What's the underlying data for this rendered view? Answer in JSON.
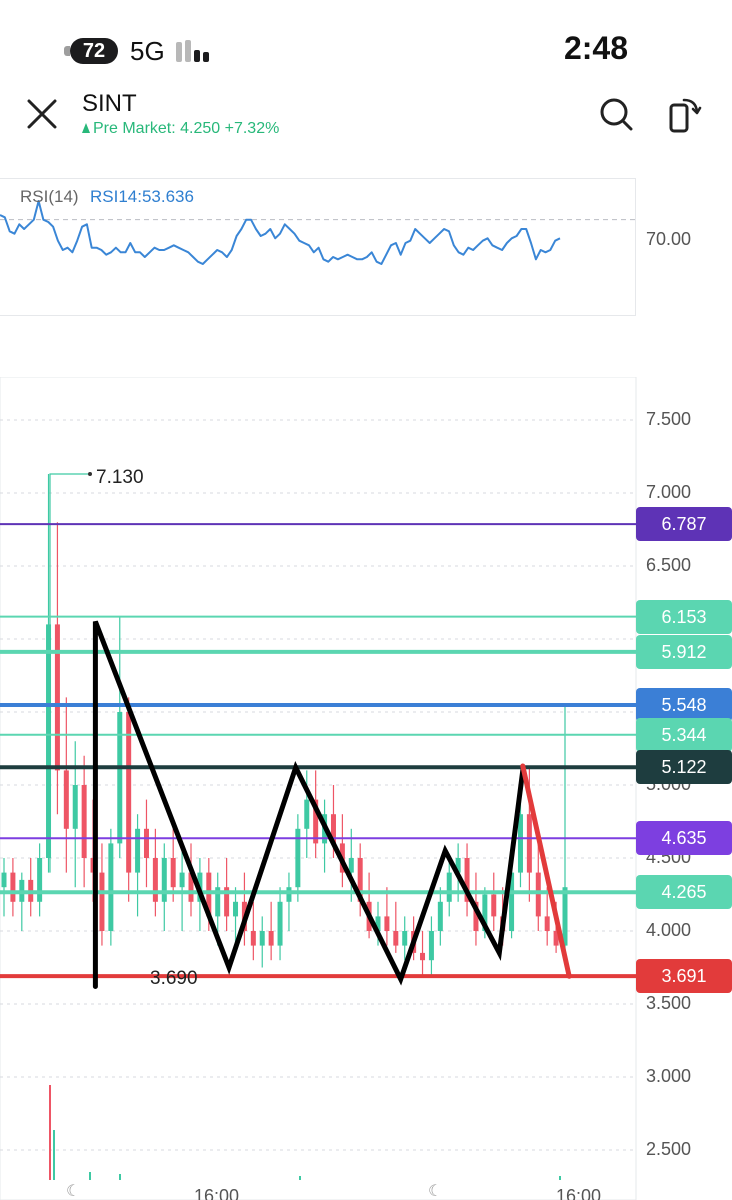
{
  "status_bar": {
    "battery": "72",
    "network": "5G",
    "time": "2:48"
  },
  "header": {
    "ticker": "SINT",
    "premarket_text": "Pre Market: 4.250 +7.32%",
    "icons": [
      "close-icon",
      "search-icon",
      "rotate-screen-icon"
    ]
  },
  "colors": {
    "up": "#3ec9a3",
    "down": "#ee5565",
    "rsi_line": "#3a86d6",
    "premarket": "#28b87a",
    "support_red": "#e23b3b",
    "resistance_dark": "#1e3d3f",
    "level_purple": "#7d3fe0",
    "level_deep_purple": "#5e33b6",
    "level_blue": "#3b7fd6",
    "level_teal": "#5bd6b1",
    "drawing_black": "#000000",
    "drawing_red": "#e23b3b"
  },
  "chart_data": [
    {
      "type": "line",
      "title": "RSI(14)",
      "value_label": "RSI14:53.636",
      "reference_level": "70.00",
      "reference_value": 70,
      "ylim": [
        30,
        75
      ],
      "values": [
        72,
        71,
        65,
        64,
        68,
        66,
        68,
        70,
        78,
        70,
        69,
        67,
        61,
        57,
        58,
        56,
        61,
        67,
        68,
        58,
        58,
        57,
        55,
        56,
        58,
        56,
        56,
        60,
        56,
        56,
        54,
        56,
        58,
        57,
        57,
        58,
        59,
        58,
        57,
        56,
        54,
        52,
        51,
        53,
        55,
        57,
        56,
        54,
        57,
        63,
        66,
        70,
        70,
        66,
        63,
        64,
        66,
        62,
        64,
        68,
        66,
        64,
        61,
        60,
        59,
        56,
        58,
        53,
        52,
        54,
        53,
        54,
        55,
        54,
        53,
        53,
        54,
        56,
        52,
        51,
        55,
        59,
        60,
        55,
        60,
        61,
        66,
        64,
        62,
        60,
        62,
        64,
        66,
        65,
        59,
        56,
        55,
        58,
        57,
        59,
        61,
        62,
        59,
        58,
        57,
        60,
        62,
        63,
        66,
        66,
        60,
        53,
        57,
        56,
        57,
        61,
        62
      ]
    },
    {
      "type": "candlestick",
      "ylim": [
        2.25,
        7.7
      ],
      "axis_ticks": [
        "7.500",
        "7.000",
        "6.500",
        "5.000",
        "4.500",
        "4.000",
        "3.500",
        "3.000",
        "2.500"
      ],
      "x_ticks": [
        "16:00",
        "16:00"
      ],
      "annotations": {
        "high": "7.130",
        "low": "3.690"
      },
      "price_levels": [
        {
          "label": "6.787",
          "value": 6.787,
          "color": "#5e33b6",
          "thick": false
        },
        {
          "label": "6.153",
          "value": 6.153,
          "color": "#5bd6b1",
          "thick": false
        },
        {
          "label": "5.912",
          "value": 5.912,
          "color": "#5bd6b1",
          "thick": true
        },
        {
          "label": "5.548",
          "value": 5.548,
          "color": "#3b7fd6",
          "thick": true
        },
        {
          "label": "5.344",
          "value": 5.344,
          "color": "#5bd6b1",
          "thick": false
        },
        {
          "label": "5.122",
          "value": 5.122,
          "color": "#1e3d3f",
          "thick": true
        },
        {
          "label": "4.635",
          "value": 4.635,
          "color": "#7d3fe0",
          "thick": false
        },
        {
          "label": "4.265",
          "value": 4.265,
          "color": "#5bd6b1",
          "thick": true
        },
        {
          "label": "3.691",
          "value": 3.691,
          "color": "#e23b3b",
          "thick": true
        }
      ],
      "zigzag_black": [
        {
          "x": 0.15,
          "y": 3.62
        },
        {
          "x": 0.15,
          "y": 6.12
        },
        {
          "x": 0.36,
          "y": 3.75
        },
        {
          "x": 0.465,
          "y": 5.12
        },
        {
          "x": 0.63,
          "y": 3.67
        },
        {
          "x": 0.7,
          "y": 4.55
        },
        {
          "x": 0.785,
          "y": 3.85
        },
        {
          "x": 0.822,
          "y": 5.1
        }
      ],
      "zigzag_red": [
        {
          "x": 0.822,
          "y": 5.13
        },
        {
          "x": 0.895,
          "y": 3.69
        }
      ],
      "candles": [
        {
          "o": 4.3,
          "h": 4.5,
          "l": 4.1,
          "c": 4.4
        },
        {
          "o": 4.4,
          "h": 4.5,
          "l": 4.1,
          "c": 4.2
        },
        {
          "o": 4.2,
          "h": 4.4,
          "l": 4.0,
          "c": 4.35
        },
        {
          "o": 4.35,
          "h": 4.5,
          "l": 4.1,
          "c": 4.2
        },
        {
          "o": 4.2,
          "h": 4.6,
          "l": 4.1,
          "c": 4.5
        },
        {
          "o": 4.5,
          "h": 7.13,
          "l": 4.4,
          "c": 6.1
        },
        {
          "o": 6.1,
          "h": 6.8,
          "l": 4.8,
          "c": 5.1
        },
        {
          "o": 5.1,
          "h": 5.6,
          "l": 4.4,
          "c": 4.7
        },
        {
          "o": 4.7,
          "h": 5.3,
          "l": 4.3,
          "c": 5.0
        },
        {
          "o": 5.0,
          "h": 5.2,
          "l": 4.3,
          "c": 4.5
        },
        {
          "o": 4.5,
          "h": 4.9,
          "l": 4.2,
          "c": 4.4
        },
        {
          "o": 4.4,
          "h": 4.6,
          "l": 3.9,
          "c": 4.0
        },
        {
          "o": 4.0,
          "h": 4.7,
          "l": 3.9,
          "c": 4.6
        },
        {
          "o": 4.6,
          "h": 6.15,
          "l": 4.5,
          "c": 5.5
        },
        {
          "o": 5.5,
          "h": 5.6,
          "l": 4.2,
          "c": 4.4
        },
        {
          "o": 4.4,
          "h": 4.8,
          "l": 4.1,
          "c": 4.7
        },
        {
          "o": 4.7,
          "h": 4.9,
          "l": 4.3,
          "c": 4.5
        },
        {
          "o": 4.5,
          "h": 4.7,
          "l": 4.1,
          "c": 4.2
        },
        {
          "o": 4.2,
          "h": 4.6,
          "l": 4.0,
          "c": 4.5
        },
        {
          "o": 4.5,
          "h": 4.7,
          "l": 4.2,
          "c": 4.3
        },
        {
          "o": 4.3,
          "h": 4.6,
          "l": 4.0,
          "c": 4.4
        },
        {
          "o": 4.4,
          "h": 4.6,
          "l": 4.1,
          "c": 4.2
        },
        {
          "o": 4.2,
          "h": 4.5,
          "l": 4.0,
          "c": 4.4
        },
        {
          "o": 4.4,
          "h": 4.5,
          "l": 4.0,
          "c": 4.1
        },
        {
          "o": 4.1,
          "h": 4.4,
          "l": 3.9,
          "c": 4.3
        },
        {
          "o": 4.3,
          "h": 4.5,
          "l": 4.0,
          "c": 4.1
        },
        {
          "o": 4.1,
          "h": 4.3,
          "l": 3.9,
          "c": 4.2
        },
        {
          "o": 4.2,
          "h": 4.4,
          "l": 3.9,
          "c": 4.0
        },
        {
          "o": 4.0,
          "h": 4.2,
          "l": 3.8,
          "c": 3.9
        },
        {
          "o": 3.9,
          "h": 4.1,
          "l": 3.75,
          "c": 4.0
        },
        {
          "o": 4.0,
          "h": 4.2,
          "l": 3.8,
          "c": 3.9
        },
        {
          "o": 3.9,
          "h": 4.3,
          "l": 3.8,
          "c": 4.2
        },
        {
          "o": 4.2,
          "h": 4.4,
          "l": 4.0,
          "c": 4.3
        },
        {
          "o": 4.3,
          "h": 4.8,
          "l": 4.2,
          "c": 4.7
        },
        {
          "o": 4.7,
          "h": 5.1,
          "l": 4.5,
          "c": 4.9
        },
        {
          "o": 4.9,
          "h": 5.1,
          "l": 4.5,
          "c": 4.6
        },
        {
          "o": 4.6,
          "h": 4.9,
          "l": 4.4,
          "c": 4.8
        },
        {
          "o": 4.8,
          "h": 5.0,
          "l": 4.5,
          "c": 4.6
        },
        {
          "o": 4.6,
          "h": 4.8,
          "l": 4.3,
          "c": 4.4
        },
        {
          "o": 4.4,
          "h": 4.7,
          "l": 4.2,
          "c": 4.5
        },
        {
          "o": 4.5,
          "h": 4.6,
          "l": 4.1,
          "c": 4.2
        },
        {
          "o": 4.2,
          "h": 4.4,
          "l": 3.95,
          "c": 4.0
        },
        {
          "o": 4.0,
          "h": 4.2,
          "l": 3.9,
          "c": 4.1
        },
        {
          "o": 4.1,
          "h": 4.3,
          "l": 3.9,
          "c": 4.0
        },
        {
          "o": 4.0,
          "h": 4.2,
          "l": 3.85,
          "c": 3.9
        },
        {
          "o": 3.9,
          "h": 4.1,
          "l": 3.8,
          "c": 4.0
        },
        {
          "o": 4.0,
          "h": 4.1,
          "l": 3.8,
          "c": 3.85
        },
        {
          "o": 3.85,
          "h": 4.0,
          "l": 3.7,
          "c": 3.8
        },
        {
          "o": 3.8,
          "h": 4.1,
          "l": 3.7,
          "c": 4.0
        },
        {
          "o": 4.0,
          "h": 4.3,
          "l": 3.9,
          "c": 4.2
        },
        {
          "o": 4.2,
          "h": 4.5,
          "l": 4.1,
          "c": 4.4
        },
        {
          "o": 4.4,
          "h": 4.6,
          "l": 4.2,
          "c": 4.5
        },
        {
          "o": 4.5,
          "h": 4.6,
          "l": 4.1,
          "c": 4.2
        },
        {
          "o": 4.2,
          "h": 4.4,
          "l": 3.9,
          "c": 4.0
        },
        {
          "o": 4.0,
          "h": 4.3,
          "l": 3.95,
          "c": 4.25
        },
        {
          "o": 4.25,
          "h": 4.4,
          "l": 4.0,
          "c": 4.1
        },
        {
          "o": 4.1,
          "h": 4.3,
          "l": 3.9,
          "c": 4.0
        },
        {
          "o": 4.0,
          "h": 4.5,
          "l": 3.95,
          "c": 4.4
        },
        {
          "o": 4.4,
          "h": 4.9,
          "l": 4.3,
          "c": 4.8
        },
        {
          "o": 4.8,
          "h": 5.12,
          "l": 4.2,
          "c": 4.4
        },
        {
          "o": 4.4,
          "h": 4.6,
          "l": 4.0,
          "c": 4.1
        },
        {
          "o": 4.1,
          "h": 4.3,
          "l": 3.9,
          "c": 4.0
        },
        {
          "o": 4.0,
          "h": 4.2,
          "l": 3.85,
          "c": 3.9
        },
        {
          "o": 3.9,
          "h": 5.55,
          "l": 3.85,
          "c": 4.3
        }
      ]
    }
  ]
}
